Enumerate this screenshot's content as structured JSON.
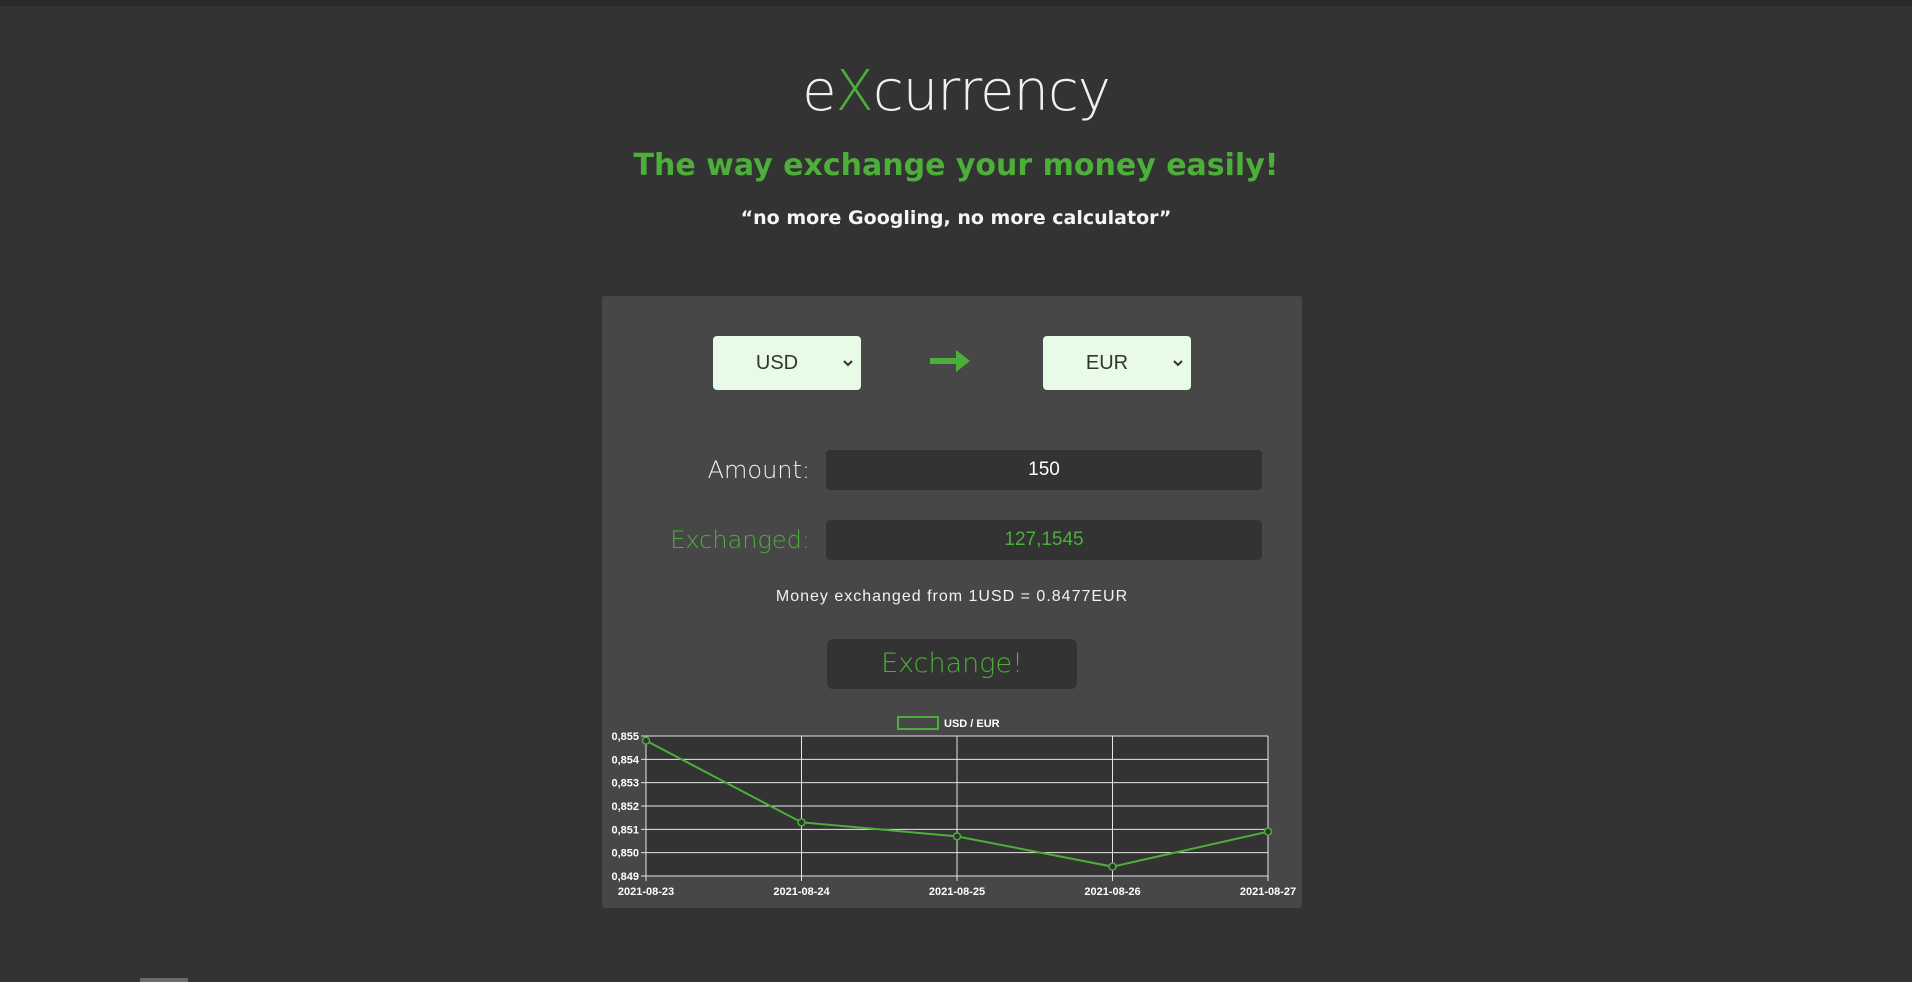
{
  "header": {
    "logo_prefix": "e",
    "logo_x": "X",
    "logo_suffix": "currency",
    "tagline": "The way exchange your money easily!",
    "quote": "“no more Googling, no more calculator”"
  },
  "converter": {
    "from_currency": "USD",
    "to_currency": "EUR",
    "amount_label": "Amount:",
    "amount_value": "150",
    "exchanged_label": "Exchanged:",
    "exchanged_value": "127,1545",
    "rate_text": "Money exchanged from 1USD = 0.8477EUR",
    "button_label": "Exchange!"
  },
  "colors": {
    "accent": "#4caf3a",
    "background": "#333333",
    "card": "#474747",
    "select_bg": "#e8fbe6"
  },
  "chart_data": {
    "type": "line",
    "legend": "USD / EUR",
    "categories": [
      "2021-08-23",
      "2021-08-24",
      "2021-08-25",
      "2021-08-26",
      "2021-08-27"
    ],
    "y_tick_labels": [
      "0,855",
      "0,854",
      "0,853",
      "0,852",
      "0,851",
      "0,850",
      "0,849"
    ],
    "series": [
      {
        "name": "USD / EUR",
        "values": [
          0.8548,
          0.8513,
          0.8507,
          0.8494,
          0.8509
        ]
      }
    ],
    "ylim": [
      0.849,
      0.855
    ],
    "grid": true
  }
}
